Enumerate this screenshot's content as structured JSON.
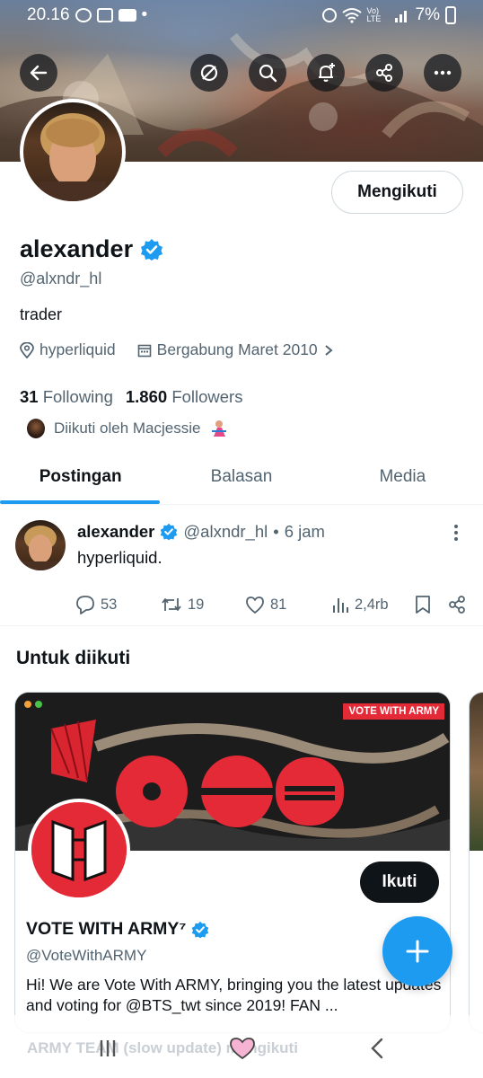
{
  "status_bar": {
    "time": "20.16",
    "battery": "7%",
    "network": "Vo) LTE"
  },
  "profile": {
    "display_name": "alexander",
    "handle": "@alxndr_hl",
    "bio": "trader",
    "location": "hyperliquid",
    "joined": "Bergabung Maret 2010",
    "following_count": "31",
    "following_label": "Following",
    "followers_count": "1.860",
    "followers_label": "Followers",
    "followed_by": "Diikuti oleh Macjessie",
    "follow_button": "Mengikuti"
  },
  "tabs": [
    {
      "label": "Postingan",
      "active": true
    },
    {
      "label": "Balasan",
      "active": false
    },
    {
      "label": "Media",
      "active": false
    }
  ],
  "tweet": {
    "name": "alexander",
    "handle": "@alxndr_hl",
    "time": "6 jam",
    "separator": "•",
    "text": "hyperliquid.",
    "replies": "53",
    "retweets": "19",
    "likes": "81",
    "views": "2,4rb"
  },
  "suggestions": {
    "title": "Untuk diikuti",
    "card": {
      "banner_tag": "VOTE WITH ARMY",
      "name": "VOTE WITH ARMY⁷",
      "handle": "@VoteWithARMY",
      "bio": "Hi! We are Vote With ARMY, bringing you the latest updates and voting for @BTS_twt since 2019! FAN ...",
      "button": "Ikuti"
    }
  },
  "bottom": {
    "faded_text": "ARMY TEAM (slow update) mengikuti"
  },
  "colors": {
    "accent": "#1d9bf0",
    "text": "#0f1419",
    "muted": "#536471",
    "brand_red": "#e52a37"
  },
  "icons": [
    "back-arrow-icon",
    "grok-icon",
    "search-icon",
    "notification-bell-icon",
    "share-icon",
    "more-icon",
    "verified-badge-icon",
    "location-icon",
    "calendar-icon",
    "chevron-right-icon",
    "reply-icon",
    "retweet-icon",
    "like-icon",
    "views-icon",
    "bookmark-icon",
    "compose-plus-icon",
    "recents-nav-icon",
    "home-nav-icon",
    "back-nav-icon"
  ]
}
